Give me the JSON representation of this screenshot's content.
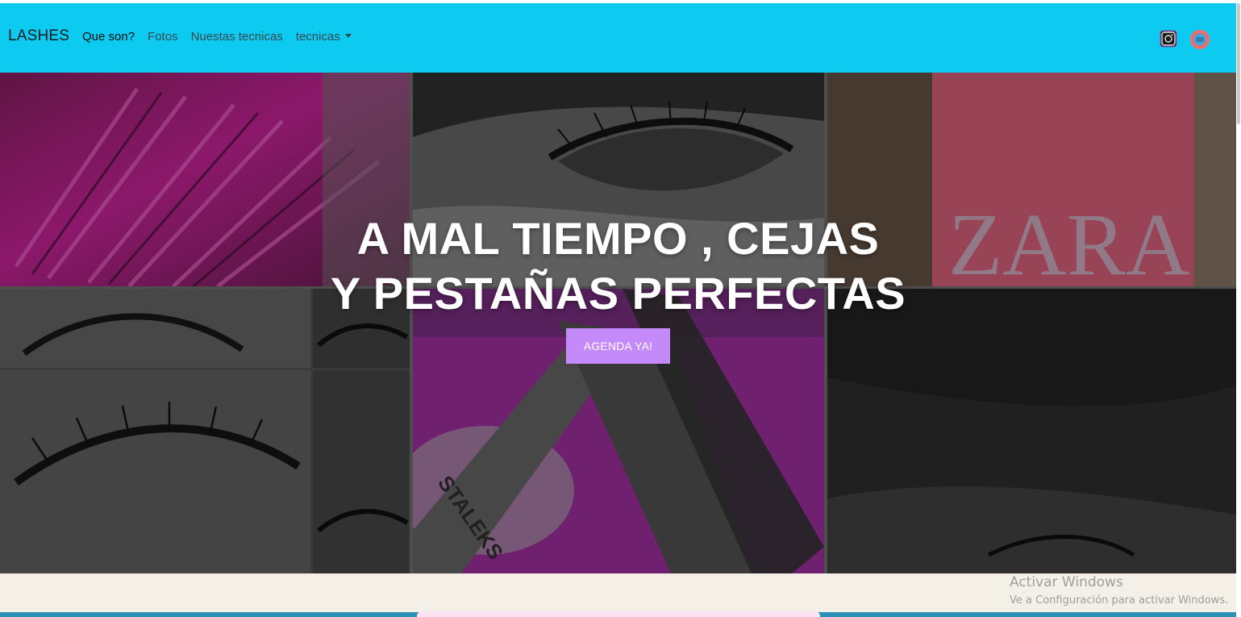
{
  "navbar": {
    "brand": "LASHES",
    "background": "#0dcaf0",
    "links": [
      {
        "label": "Que son?",
        "active": true
      },
      {
        "label": "Fotos"
      },
      {
        "label": "Nuestas tecnicas"
      },
      {
        "label": "tecnicas",
        "dropdown": true
      }
    ],
    "social": [
      {
        "icon": "instagram-icon"
      },
      {
        "icon": "youtube-icon"
      }
    ]
  },
  "hero": {
    "title_line1": "A MAL TIEMPO , CEJAS",
    "title_line2": "Y PESTAÑAS PERFECTAS",
    "cta_label": "AGENDA YA!",
    "cta_color": "#c58af9",
    "collage": [
      {
        "name": "magenta-lash-brush-photo"
      },
      {
        "name": "eye-closeup-photo"
      },
      {
        "name": "shopping-bag-photo"
      },
      {
        "name": "lash-eyes-collage-photo"
      },
      {
        "name": "tweezers-photo"
      },
      {
        "name": "dark-lash-closeup-photo"
      }
    ],
    "bag_text": "ZARA",
    "tweezers_text": "STALEKS"
  },
  "os_watermark": {
    "title": "Activar Windows",
    "subtitle": "Ve a Configuración para activar Windows."
  }
}
